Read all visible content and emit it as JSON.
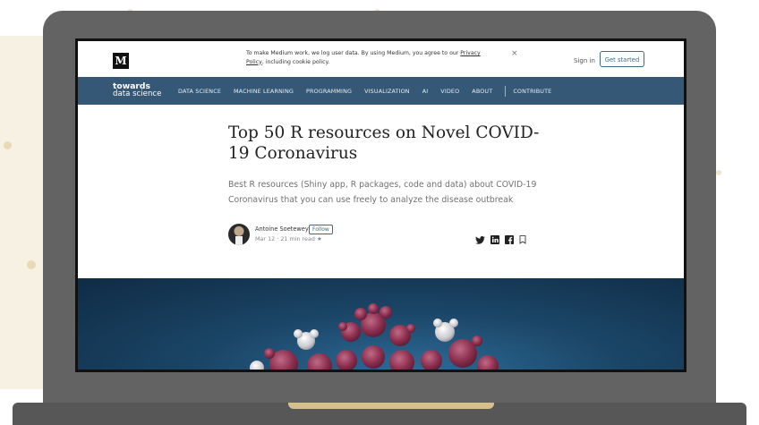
{
  "cookie_banner": {
    "text": "To make Medium work, we log user data. By using Medium, you agree to our",
    "link": "Privacy Policy",
    "text2": ", including cookie policy.",
    "close": "×"
  },
  "header": {
    "logo": "M",
    "signin": "Sign in",
    "get_started": "Get started"
  },
  "nav": {
    "brand_line1": "towards",
    "brand_line2": "data science",
    "items": [
      {
        "label": "DATA SCIENCE"
      },
      {
        "label": "MACHINE LEARNING"
      },
      {
        "label": "PROGRAMMING"
      },
      {
        "label": "VISUALIZATION"
      },
      {
        "label": "AI"
      },
      {
        "label": "VIDEO"
      },
      {
        "label": "ABOUT"
      },
      {
        "label": "CONTRIBUTE"
      }
    ]
  },
  "article": {
    "title": "Top 50 R resources on Novel COVID-19 Coronavirus",
    "subtitle": "Best R resources (Shiny app, R packages, code and data) about COVID-19 Coronavirus that you can use freely to analyze the disease outbreak",
    "author": "Antoine Soetewey",
    "follow": "Follow",
    "meta": "Mar 12 · 21 min read ★"
  },
  "icons": {
    "share": [
      "twitter-icon",
      "linkedin-icon",
      "facebook-icon",
      "bookmark-icon"
    ]
  },
  "colors": {
    "nav_bg": "#355876",
    "laptop": "#636363",
    "accent": "#3f6a82"
  }
}
